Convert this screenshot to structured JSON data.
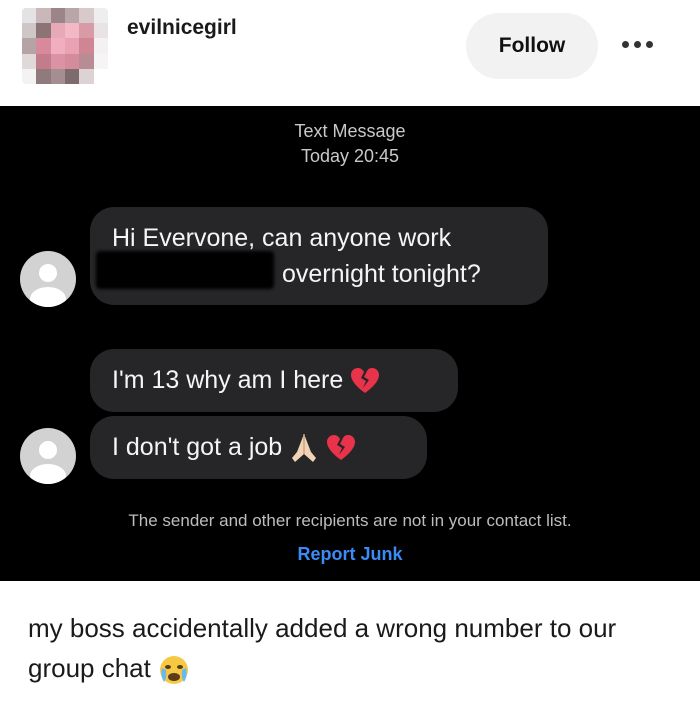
{
  "post": {
    "username": "evilnicegirl",
    "follow_label": "Follow",
    "more_icon": "more-dots-icon",
    "caption": "my boss accidentally added a wrong number to our group chat",
    "caption_emoji": "crying-face-emoji"
  },
  "thread": {
    "label": "Text Message",
    "time": "Today 20:45",
    "messages": [
      {
        "line1": "Hi Evervone, can anyone work",
        "line2": "overnight tonight?"
      },
      {
        "text": "I'm 13 why am I here",
        "emoji": "broken-heart"
      },
      {
        "text": "I don't got a job",
        "emoji": "folded-hands broken-heart"
      }
    ],
    "disclaimer": "The sender and other recipients are not in your contact list.",
    "report_label": "Report Junk"
  },
  "colors": {
    "thread_bg": "#000000",
    "bubble_bg": "#262629",
    "link_blue": "#3b8bf7",
    "follow_bg": "#f2f2f2"
  }
}
